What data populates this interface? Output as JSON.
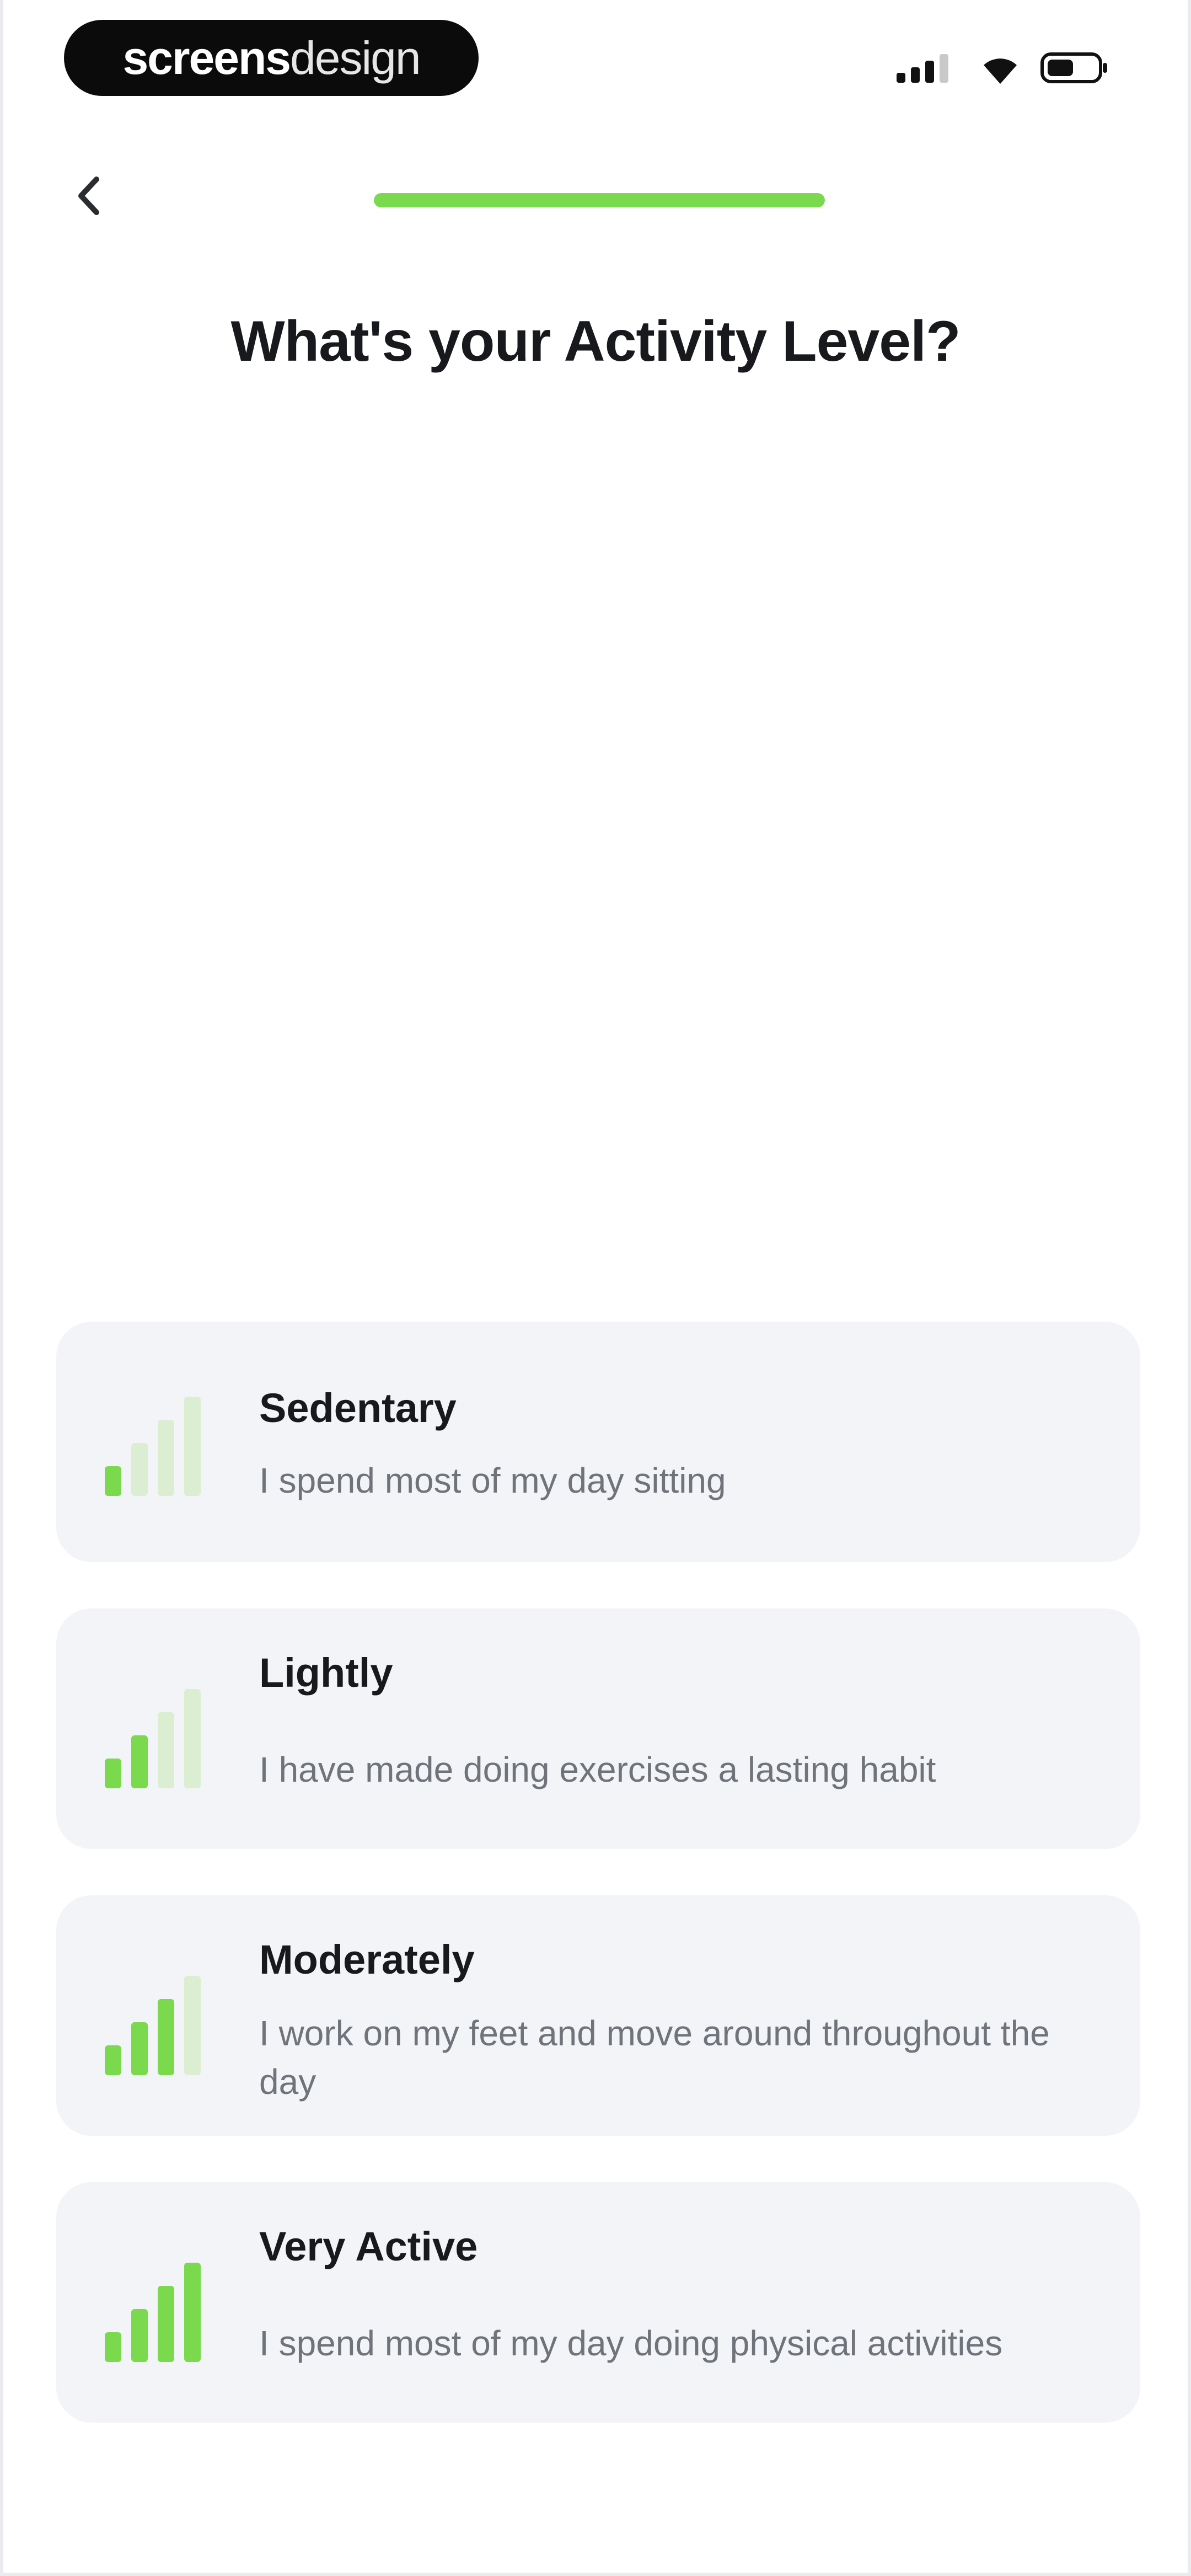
{
  "status_bar": {
    "brand_bold": "screens",
    "brand_light": "design"
  },
  "header": {
    "back_icon": "chevron-left-icon",
    "progress": 1.0
  },
  "title": "What's your Activity Level?",
  "options": [
    {
      "title": "Sedentary",
      "description": "I spend most of my day sitting",
      "level": 1,
      "max_level": 4
    },
    {
      "title": "Lightly",
      "description": "I have made doing exercises a lasting habit",
      "level": 2,
      "max_level": 4
    },
    {
      "title": "Moderately",
      "description": "I work on my feet and move around throughout the day",
      "level": 3,
      "max_level": 4
    },
    {
      "title": "Very Active",
      "description": "I spend most of my day doing physical activities",
      "level": 4,
      "max_level": 4
    }
  ],
  "colors": {
    "accent": "#7ad94d",
    "inactive_bar": "#dbeed2",
    "card_bg": "#f3f4f7",
    "title_text": "#17191c",
    "desc_text": "#6f737a"
  }
}
